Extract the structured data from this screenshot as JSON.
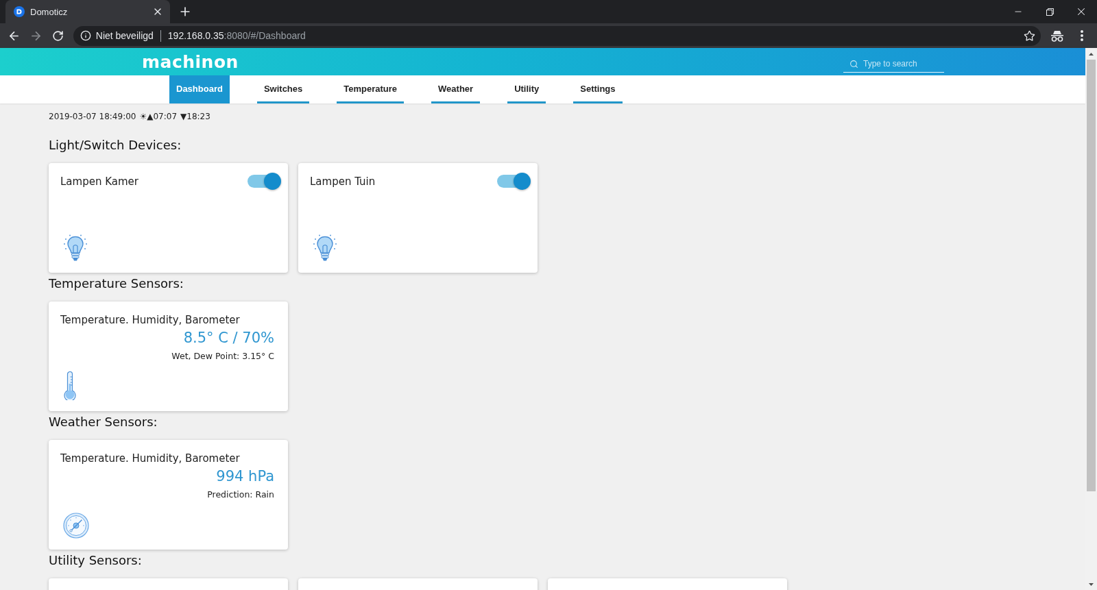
{
  "browser": {
    "tab": {
      "title": "Domoticz",
      "selected": true
    },
    "security_label": "Niet beveiligd",
    "url_host": "192.168.0.35",
    "url_path": ":8080/#/Dashboard"
  },
  "header": {
    "logo": "machinon",
    "search": {
      "placeholder": "Type to search"
    }
  },
  "nav": [
    {
      "label": "Dashboard",
      "selected": true
    },
    {
      "label": "Switches",
      "selected": false
    },
    {
      "label": "Temperature",
      "selected": false
    },
    {
      "label": "Weather",
      "selected": false
    },
    {
      "label": "Utility",
      "selected": false
    },
    {
      "label": "Settings",
      "selected": false
    }
  ],
  "status_line": {
    "datetime": "2019-03-07 18:49:00",
    "sunrise": "☀▲07:07",
    "sunset": "▼18:23"
  },
  "sections": [
    {
      "title": "Light/Switch Devices:",
      "devices": [
        {
          "kind": "switch",
          "name": "Lampen Kamer",
          "on": true
        },
        {
          "kind": "switch",
          "name": "Lampen Tuin",
          "on": true
        }
      ]
    },
    {
      "title": "Temperature Sensors:",
      "devices": [
        {
          "kind": "temperature",
          "name": "Temperature. Humidity, Barometer",
          "value": "8.5° C / 70%",
          "status": "Wet, Dew Point: 3.15° C"
        }
      ]
    },
    {
      "title": "Weather Sensors:",
      "devices": [
        {
          "kind": "barometer",
          "name": "Temperature. Humidity, Barometer",
          "value": "994 hPa",
          "status": "Prediction: Rain"
        }
      ]
    },
    {
      "title": "Utility Sensors:",
      "devices": [
        {
          "kind": "offscreen"
        },
        {
          "kind": "offscreen"
        },
        {
          "kind": "offscreen"
        }
      ]
    }
  ]
}
